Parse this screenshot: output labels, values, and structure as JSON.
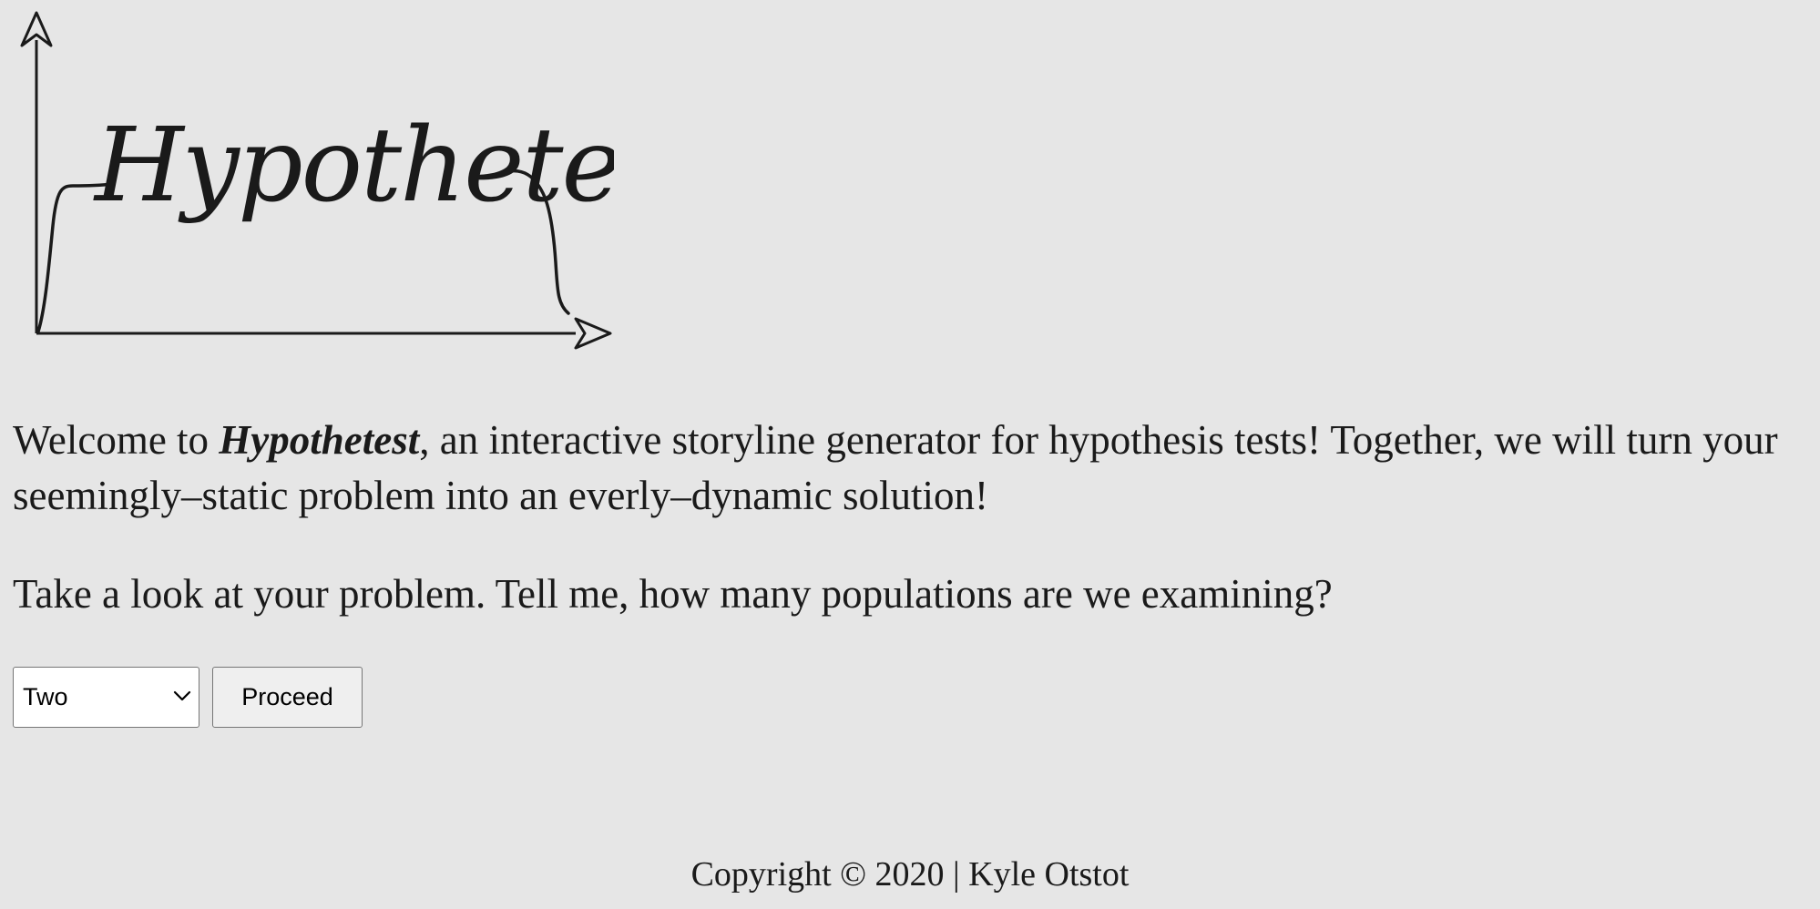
{
  "logo": {
    "text": "Hypothetest"
  },
  "intro": {
    "prefix": "Welcome to ",
    "brand": "Hypothetest",
    "suffix": ", an interactive storyline generator for hypothesis tests! Together, we will turn your seemingly–static problem into an everly–dynamic solution!"
  },
  "question": {
    "text": "Take a look at your problem. Tell me, how many populations are we examining?"
  },
  "controls": {
    "population_select_value": "Two",
    "proceed_label": "Proceed"
  },
  "footer": {
    "text": "Copyright © 2020 | Kyle Otstot"
  }
}
